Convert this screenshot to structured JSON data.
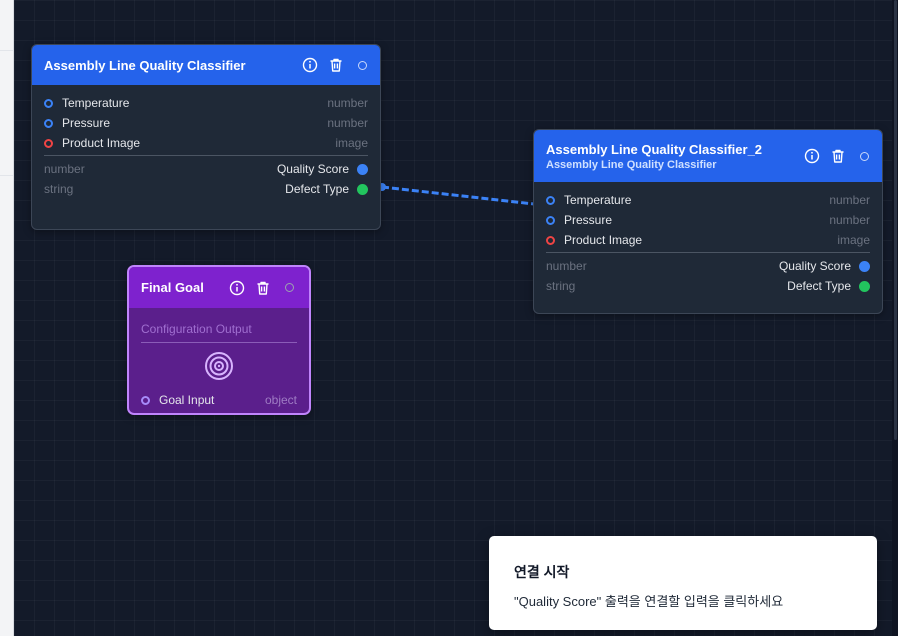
{
  "nodes": {
    "classifier1": {
      "title": "Assembly Line Quality Classifier",
      "inputs": [
        {
          "label": "Temperature",
          "type": "number"
        },
        {
          "label": "Pressure",
          "type": "number"
        },
        {
          "label": "Product Image",
          "type": "image"
        }
      ],
      "outputs": [
        {
          "type": "number",
          "label": "Quality Score"
        },
        {
          "type": "string",
          "label": "Defect Type"
        }
      ]
    },
    "classifier2": {
      "title": "Assembly Line Quality Classifier_2",
      "subtitle": "Assembly Line Quality Classifier",
      "inputs": [
        {
          "label": "Temperature",
          "type": "number"
        },
        {
          "label": "Pressure",
          "type": "number"
        },
        {
          "label": "Product Image",
          "type": "image"
        }
      ],
      "outputs": [
        {
          "type": "number",
          "label": "Quality Score"
        },
        {
          "type": "string",
          "label": "Defect Type"
        }
      ]
    },
    "goal": {
      "title": "Final Goal",
      "section_label": "Configuration Output",
      "input": {
        "label": "Goal Input",
        "type": "object"
      }
    }
  },
  "toast": {
    "title": "연결 시작",
    "message": "\"Quality Score\" 출력을 연결할 입력을 클릭하세요"
  },
  "icons": {
    "info": "info-icon",
    "delete": "trash-icon",
    "status": "status-circle-icon",
    "target": "target-icon"
  },
  "colors": {
    "canvas": "#131a29",
    "node_header": "#2563eb",
    "goal_header": "#7e22ce",
    "goal_border": "#c084fc",
    "port_number": "#3b82f6",
    "port_image": "#ef4444",
    "output_number": "#3b82f6",
    "output_string": "#22c55e",
    "connection": "#3b82f6"
  }
}
